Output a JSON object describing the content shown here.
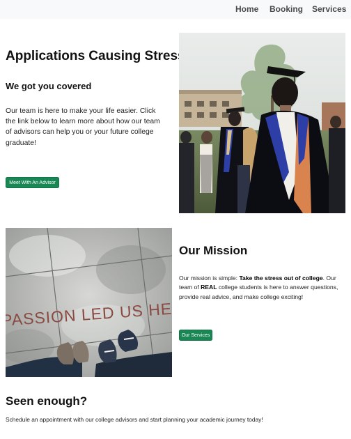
{
  "nav": {
    "home": "Home",
    "booking": "Booking",
    "services": "Services"
  },
  "hero": {
    "title": "Applications Causing Stress?",
    "subtitle": "We got you covered",
    "text": "Our team is here to make your life easier. Click the link below to learn more about how our team of advisors can help you or your future college graduate!",
    "button": "Meet With An Advisor"
  },
  "mission": {
    "title": "Our Mission",
    "text_1": "Our mission is simple: ",
    "text_bold_1": "Take the stress out of college",
    "text_2": ". Our team of ",
    "text_bold_2": "REAL",
    "text_3": " college students is here to answer questions, provide real advice, and make college exciting!",
    "button": "Our Services"
  },
  "photos": {
    "sidewalk_text": "PASSION LED US HERE"
  },
  "cta": {
    "title": "Seen enough?",
    "text": "Schedule an appointment with our college advisors and start planning your academic journey today!"
  },
  "colors": {
    "accent": "#198754",
    "navbar_bg": "#f8f9fa"
  }
}
